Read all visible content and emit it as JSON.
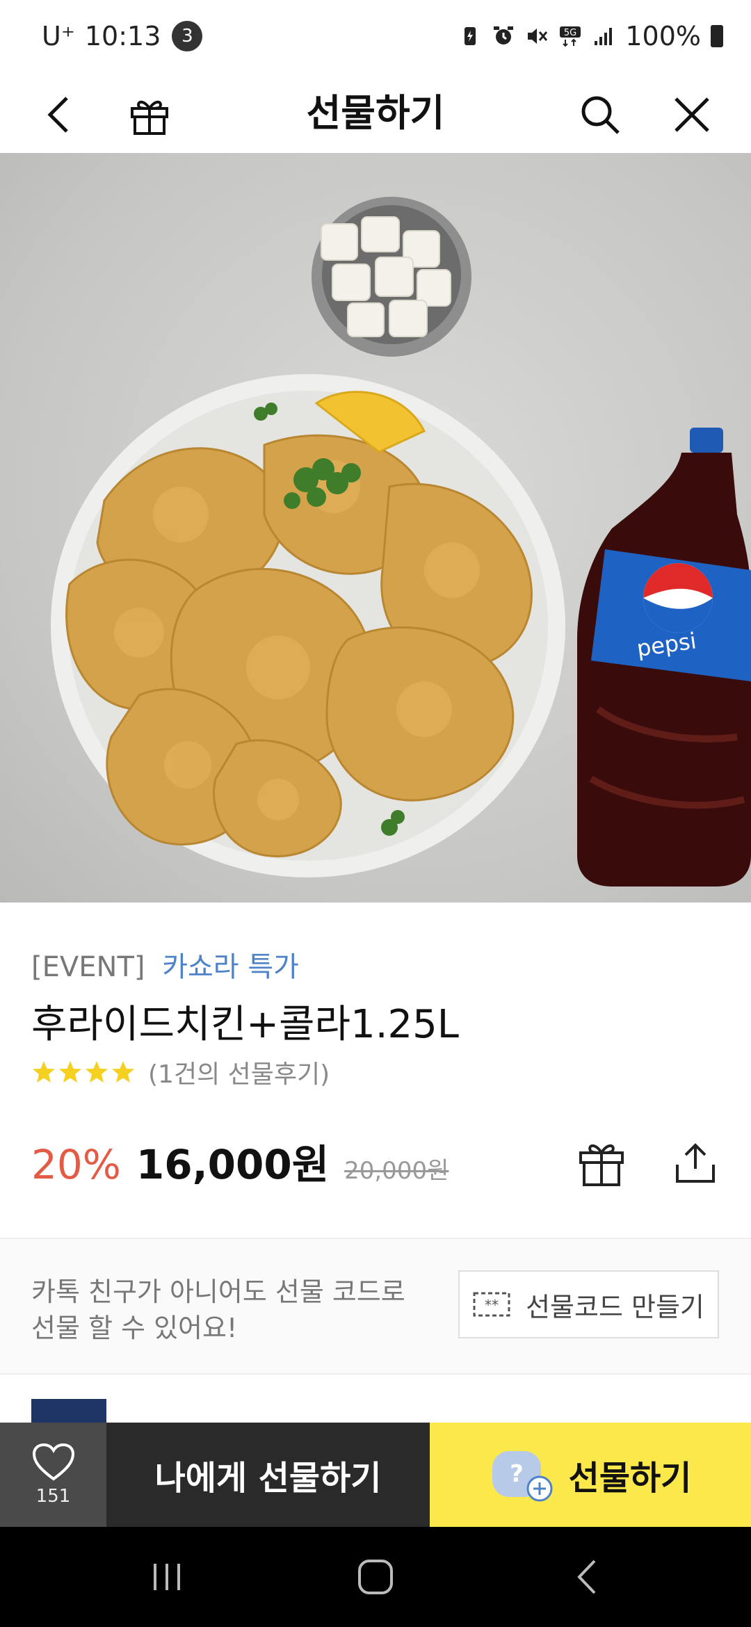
{
  "status_bar": {
    "carrier": "U⁺",
    "time": "10:13",
    "notification_count": "3",
    "battery_text": "100%"
  },
  "app_bar": {
    "title": "선물하기"
  },
  "product": {
    "event_tag": "[EVENT]",
    "promo_label": "카쇼라 특가",
    "name": "후라이드치킨+콜라1.25L",
    "rating_stars": 4,
    "review_count": "(1건의 선물후기)",
    "discount": "20%",
    "price": "16,000원",
    "original_price": "20,000원"
  },
  "gift_code": {
    "description": "카톡 친구가 아니어도 선물 코드로 선물 할 수 있어요!",
    "button_label": "선물코드 만들기"
  },
  "bottom_bar": {
    "like_count": "151",
    "self_gift_label": "나에게 선물하기",
    "gift_label": "선물하기"
  },
  "colors": {
    "accent_blue": "#4d82c9",
    "discount_red": "#e35a45",
    "gift_yellow": "#fbe84b",
    "star_yellow": "#f5d020"
  }
}
